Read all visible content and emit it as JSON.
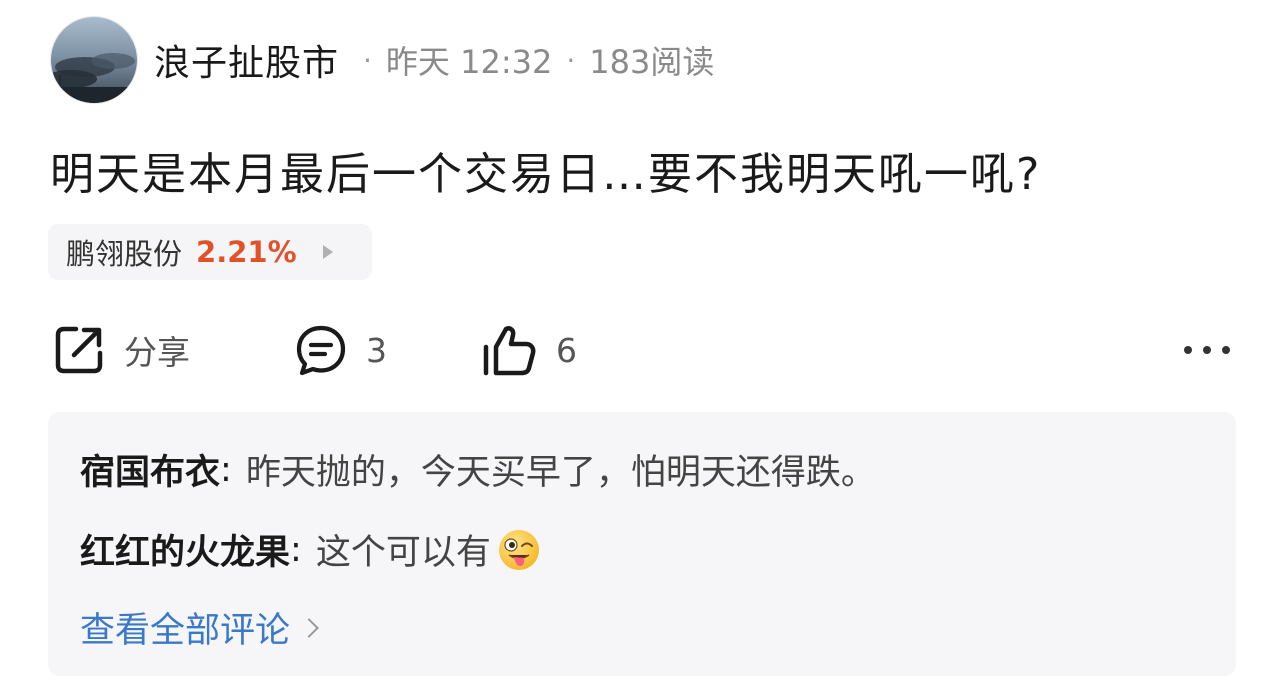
{
  "post": {
    "author": "浪子扯股市",
    "time": "昨天 12:32",
    "reads": "183阅读",
    "separator": "·",
    "text": "明天是本月最后一个交易日…要不我明天吼一吼?"
  },
  "stock": {
    "name": "鹏翎股份",
    "change": "2.21%",
    "change_color": "#e0522a"
  },
  "actions": {
    "share_label": "分享",
    "comment_count": "3",
    "like_count": "6",
    "icons": [
      "share-icon",
      "comment-icon",
      "like-icon",
      "more-icon"
    ]
  },
  "comments": {
    "items": [
      {
        "user": "宿国布衣",
        "separator": ":",
        "text": "昨天抛的，今天买早了，怕明天还得跌。"
      },
      {
        "user": "红红的火龙果",
        "separator": ":",
        "text": "这个可以有",
        "emoji": "winking-tongue-emoji"
      }
    ],
    "view_all": "查看全部评论",
    "link_color": "#3a78c9"
  }
}
